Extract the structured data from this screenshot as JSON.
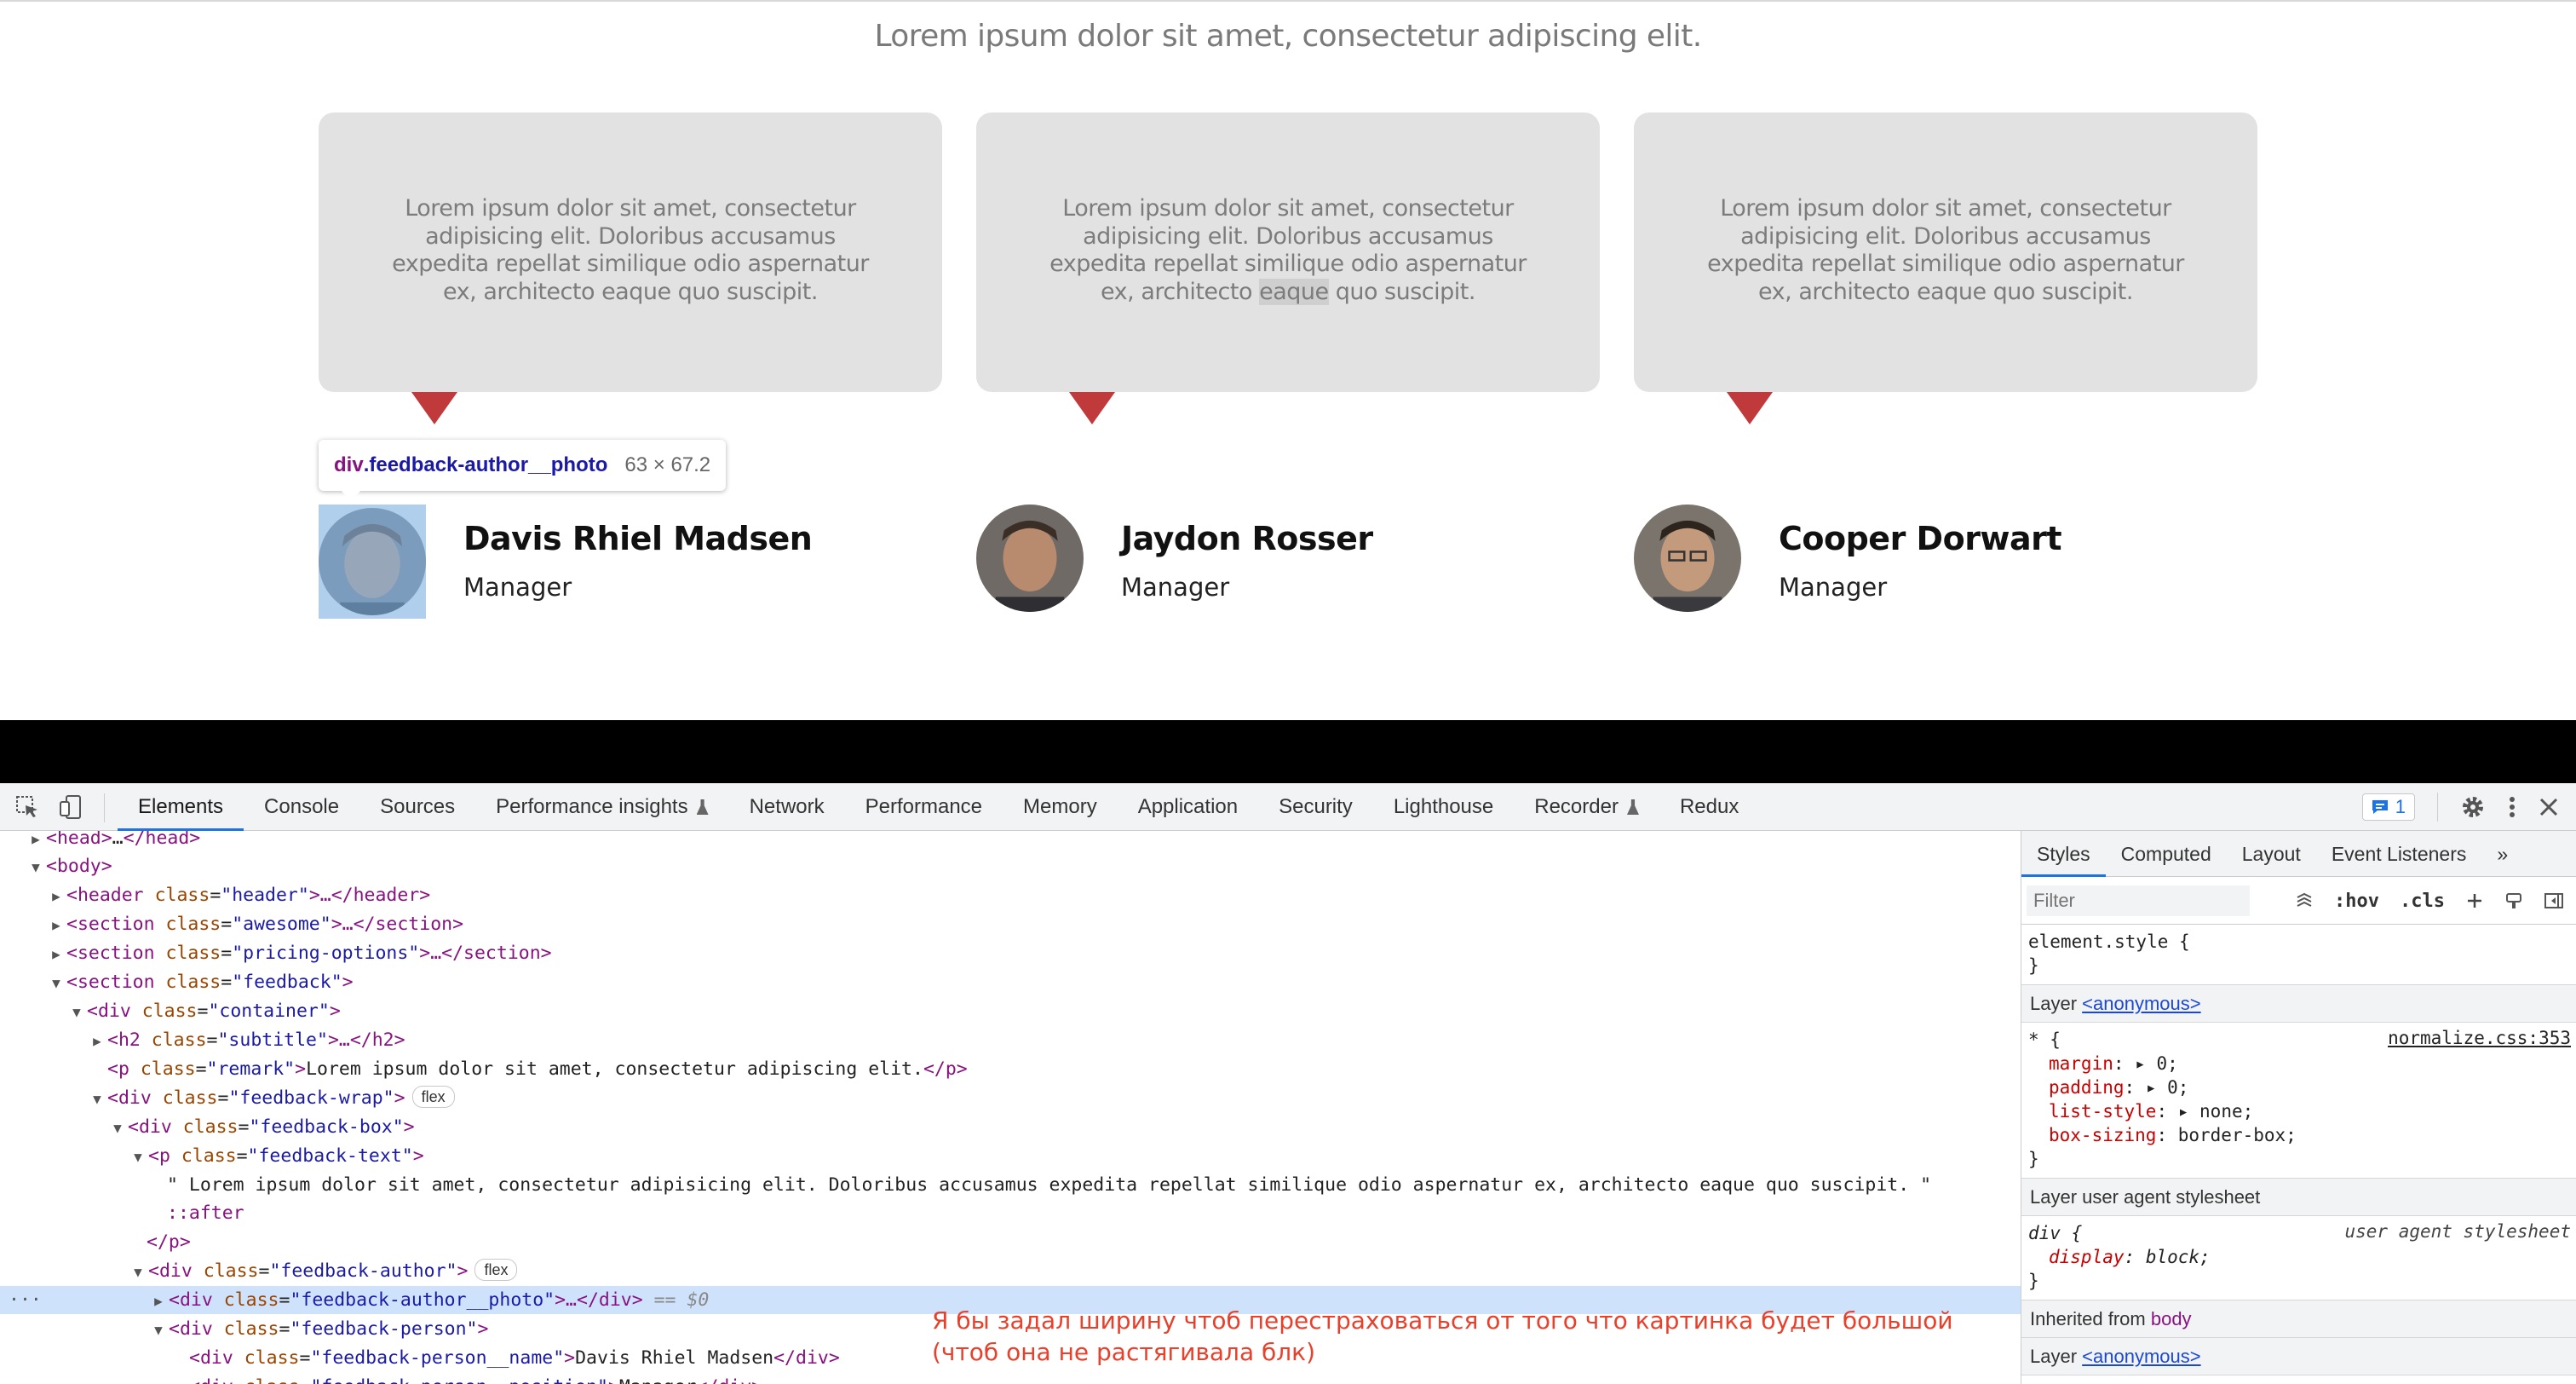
{
  "page": {
    "remark": "Lorem ipsum dolor sit amet, consectetur adipiscing elit.",
    "feedback_boxes": [
      {
        "text": "Lorem ipsum dolor sit amet, consectetur adipisicing elit. Doloribus accusamus expedita repellat similique odio aspernatur ex, architecto eaque quo suscipit."
      },
      {
        "text_before": "Lorem ipsum dolor sit amet, consectetur adipisicing elit. Doloribus accusamus expedita repellat similique odio aspernatur ex, architecto ",
        "text_highlight": "eaque",
        "text_after": " quo suscipit."
      },
      {
        "text": "Lorem ipsum dolor sit amet, consectetur adipisicing elit. Doloribus accusamus expedita repellat similique odio aspernatur ex, architecto eaque quo suscipit."
      }
    ],
    "authors": [
      {
        "name": "Davis Rhiel Madsen",
        "position": "Manager"
      },
      {
        "name": "Jaydon Rosser",
        "position": "Manager"
      },
      {
        "name": "Cooper Dorwart",
        "position": "Manager"
      }
    ],
    "inspect_tooltip": {
      "selector_tag": "div",
      "selector_class": ".feedback-author__photo",
      "size": "63 × 67.2"
    },
    "colors": {
      "pointer": "#c0393b",
      "box": "#e2e2e2",
      "highlight": "#6fa8dc"
    }
  },
  "devtools": {
    "tabs": [
      "Elements",
      "Console",
      "Sources",
      "Performance insights",
      "Network",
      "Performance",
      "Memory",
      "Application",
      "Security",
      "Lighthouse",
      "Recorder",
      "Redux"
    ],
    "active_tab": "Elements",
    "issues_count": "1",
    "dom": {
      "l1": {
        "open": "<head>",
        "dots": "…",
        "close": "</head>"
      },
      "l2": {
        "open": "<body>"
      },
      "l3": {
        "tag": "header",
        "attr": "class",
        "val": "\"header\"",
        "rest": ">…</header>"
      },
      "l4": {
        "tag": "section",
        "attr": "class",
        "val": "\"awesome\"",
        "rest": ">…</section>"
      },
      "l5": {
        "tag": "section",
        "attr": "class",
        "val": "\"pricing-options\"",
        "rest": ">…</section>"
      },
      "l6": {
        "tag": "section",
        "attr": "class",
        "val": "\"feedback\"",
        "rest": ">"
      },
      "l7": {
        "tag": "div",
        "attr": "class",
        "val": "\"container\"",
        "rest": ">"
      },
      "l8": {
        "tag": "h2",
        "attr": "class",
        "val": "\"subtitle\"",
        "rest": ">…</h2>"
      },
      "l9": {
        "tag": "p",
        "attr": "class",
        "val": "\"remark\"",
        "text": "Lorem ipsum dolor sit amet, consectetur adipiscing elit.",
        "close": "</p>"
      },
      "l10": {
        "tag": "div",
        "attr": "class",
        "val": "\"feedback-wrap\"",
        "rest": ">",
        "badge": "flex"
      },
      "l11": {
        "tag": "div",
        "attr": "class",
        "val": "\"feedback-box\"",
        "rest": ">"
      },
      "l12": {
        "tag": "p",
        "attr": "class",
        "val": "\"feedback-text\"",
        "rest": ">"
      },
      "l13": {
        "text": "\" Lorem ipsum dolor sit amet, consectetur adipisicing elit. Doloribus accusamus expedita repellat similique odio aspernatur ex, architecto eaque quo suscipit. \""
      },
      "l14": {
        "pseudo": "::after"
      },
      "l15": {
        "close": "</p>"
      },
      "l16": {
        "tag": "div",
        "attr": "class",
        "val": "\"feedback-author\"",
        "rest": ">",
        "badge": "flex"
      },
      "l17": {
        "tag": "div",
        "attr": "class",
        "val": "\"feedback-author__photo\"",
        "rest": ">…</div>",
        "eq": " == $0"
      },
      "l18": {
        "tag": "div",
        "attr": "class",
        "val": "\"feedback-person\"",
        "rest": ">"
      },
      "l19": {
        "tag": "div",
        "attr": "class",
        "val": "\"feedback-person__name\"",
        "text": "Davis Rhiel Madsen",
        "close": "</div>"
      },
      "l20": {
        "tag": "div",
        "attr": "class",
        "val": "\"feedback-person__position\"",
        "text": "Manager",
        "close": "</div>"
      }
    },
    "annotation": [
      "Я бы задал ширину чтоб перестраховаться от того что картинка будет большой",
      "(чтоб она не растягивала блк)"
    ],
    "styles": {
      "tabs": [
        "Styles",
        "Computed",
        "Layout",
        "Event Listeners"
      ],
      "filter_placeholder": "Filter",
      "hov": ":hov",
      "cls": ".cls",
      "element_style": "element.style {",
      "close_brace": "}",
      "layer1_label": "Layer ",
      "layer1_link": "<anonymous>",
      "rule1_selector": "* {",
      "rule1_source": "normalize.css:353",
      "rule1_props": [
        {
          "name": "margin",
          "arrow": "▸ ",
          "value": "0;"
        },
        {
          "name": "padding",
          "arrow": "▸ ",
          "value": "0;"
        },
        {
          "name": "list-style",
          "arrow": "▸ ",
          "value": "none;"
        },
        {
          "name": "box-sizing",
          "arrow": "",
          "value": "border-box;"
        }
      ],
      "layer2_label": "Layer user agent stylesheet",
      "rule2_selector": "div {",
      "rule2_source": "user agent stylesheet",
      "rule2_prop": {
        "name": "display",
        "value": "block;"
      },
      "inherited_label": "Inherited from ",
      "inherited_el": "body",
      "layer3_label": "Layer ",
      "layer3_link": "<anonymous>"
    }
  }
}
